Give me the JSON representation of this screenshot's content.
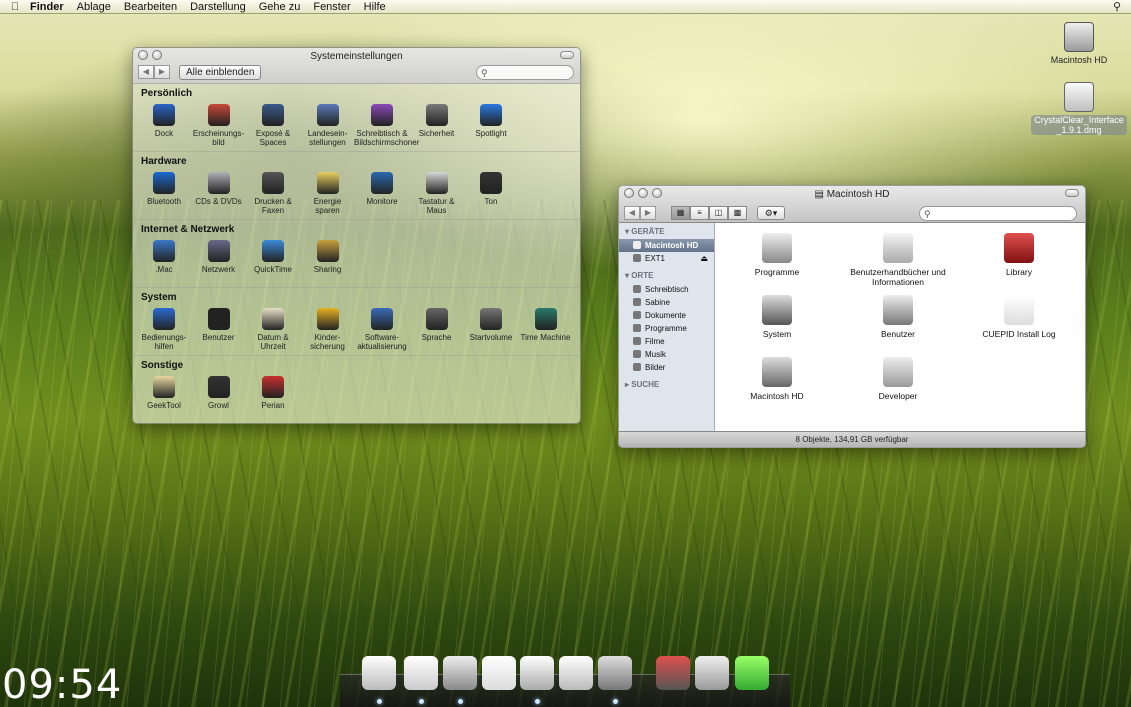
{
  "menubar": {
    "app": "Finder",
    "items": [
      "Ablage",
      "Bearbeiten",
      "Darstellung",
      "Gehe zu",
      "Fenster",
      "Hilfe"
    ]
  },
  "desktop": {
    "icons": [
      {
        "label": "Macintosh HD"
      },
      {
        "label": "CrystalClear_Interface_1.9.1.dmg"
      }
    ]
  },
  "syspref": {
    "title": "Systemeinstellungen",
    "show_all": "Alle einblenden",
    "sections": [
      {
        "heading": "Persönlich",
        "items": [
          "Dock",
          "Erscheinungs-\nbild",
          "Exposé &\nSpaces",
          "Landesein-\nstellungen",
          "Schreibtisch &\nBildschirmschoner",
          "Sicherheit",
          "Spotlight"
        ]
      },
      {
        "heading": "Hardware",
        "items": [
          "Bluetooth",
          "CDs & DVDs",
          "Drucken &\nFaxen",
          "Energie\nsparen",
          "Monitore",
          "Tastatur &\nMaus",
          "Ton"
        ]
      },
      {
        "heading": "Internet & Netzwerk",
        "items": [
          ".Mac",
          "Netzwerk",
          "QuickTime",
          "Sharing"
        ]
      },
      {
        "heading": "System",
        "items": [
          "Bedienungs-\nhilfen",
          "Benutzer",
          "Datum &\nUhrzeit",
          "Kinder-\nsicherung",
          "Software-\naktualisierung",
          "Sprache",
          "Startvolume",
          "Time Machine"
        ]
      },
      {
        "heading": "Sonstige",
        "items": [
          "GeekTool",
          "Growl",
          "Perian"
        ]
      }
    ]
  },
  "finder": {
    "title": "Macintosh HD",
    "sidebar": {
      "devices_heading": "GERÄTE",
      "devices": [
        "Macintosh HD",
        "EXT1"
      ],
      "places_heading": "ORTE",
      "places": [
        "Schreibtisch",
        "Sabine",
        "Dokumente",
        "Programme",
        "Filme",
        "Musik",
        "Bilder"
      ],
      "search_heading": "SUCHE"
    },
    "items": [
      "Programme",
      "Benutzerhandbücher und Informationen",
      "Library",
      "System",
      "Benutzer",
      "CUEPID Install Log",
      "Macintosh HD",
      "Developer"
    ],
    "status": "8 Objekte, 134,91 GB verfügbar"
  },
  "clock": "09:54",
  "colors": {
    "accent": "#64718a",
    "dock_indicator": "#cfe6ff"
  }
}
